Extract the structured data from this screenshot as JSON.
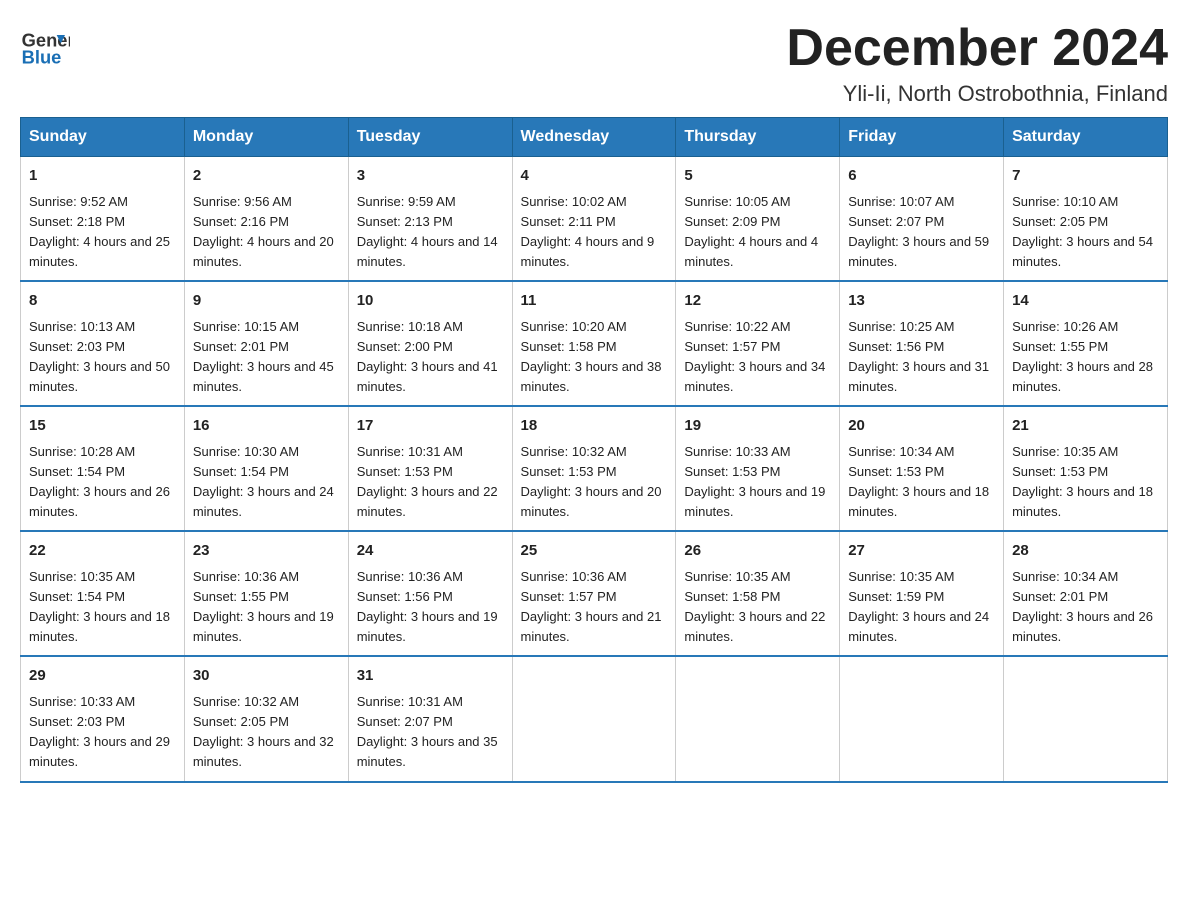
{
  "header": {
    "logo_general": "General",
    "logo_blue": "Blue",
    "month_title": "December 2024",
    "location": "Yli-Ii, North Ostrobothnia, Finland"
  },
  "days_of_week": [
    "Sunday",
    "Monday",
    "Tuesday",
    "Wednesday",
    "Thursday",
    "Friday",
    "Saturday"
  ],
  "weeks": [
    [
      {
        "day": "1",
        "sunrise": "Sunrise: 9:52 AM",
        "sunset": "Sunset: 2:18 PM",
        "daylight": "Daylight: 4 hours and 25 minutes."
      },
      {
        "day": "2",
        "sunrise": "Sunrise: 9:56 AM",
        "sunset": "Sunset: 2:16 PM",
        "daylight": "Daylight: 4 hours and 20 minutes."
      },
      {
        "day": "3",
        "sunrise": "Sunrise: 9:59 AM",
        "sunset": "Sunset: 2:13 PM",
        "daylight": "Daylight: 4 hours and 14 minutes."
      },
      {
        "day": "4",
        "sunrise": "Sunrise: 10:02 AM",
        "sunset": "Sunset: 2:11 PM",
        "daylight": "Daylight: 4 hours and 9 minutes."
      },
      {
        "day": "5",
        "sunrise": "Sunrise: 10:05 AM",
        "sunset": "Sunset: 2:09 PM",
        "daylight": "Daylight: 4 hours and 4 minutes."
      },
      {
        "day": "6",
        "sunrise": "Sunrise: 10:07 AM",
        "sunset": "Sunset: 2:07 PM",
        "daylight": "Daylight: 3 hours and 59 minutes."
      },
      {
        "day": "7",
        "sunrise": "Sunrise: 10:10 AM",
        "sunset": "Sunset: 2:05 PM",
        "daylight": "Daylight: 3 hours and 54 minutes."
      }
    ],
    [
      {
        "day": "8",
        "sunrise": "Sunrise: 10:13 AM",
        "sunset": "Sunset: 2:03 PM",
        "daylight": "Daylight: 3 hours and 50 minutes."
      },
      {
        "day": "9",
        "sunrise": "Sunrise: 10:15 AM",
        "sunset": "Sunset: 2:01 PM",
        "daylight": "Daylight: 3 hours and 45 minutes."
      },
      {
        "day": "10",
        "sunrise": "Sunrise: 10:18 AM",
        "sunset": "Sunset: 2:00 PM",
        "daylight": "Daylight: 3 hours and 41 minutes."
      },
      {
        "day": "11",
        "sunrise": "Sunrise: 10:20 AM",
        "sunset": "Sunset: 1:58 PM",
        "daylight": "Daylight: 3 hours and 38 minutes."
      },
      {
        "day": "12",
        "sunrise": "Sunrise: 10:22 AM",
        "sunset": "Sunset: 1:57 PM",
        "daylight": "Daylight: 3 hours and 34 minutes."
      },
      {
        "day": "13",
        "sunrise": "Sunrise: 10:25 AM",
        "sunset": "Sunset: 1:56 PM",
        "daylight": "Daylight: 3 hours and 31 minutes."
      },
      {
        "day": "14",
        "sunrise": "Sunrise: 10:26 AM",
        "sunset": "Sunset: 1:55 PM",
        "daylight": "Daylight: 3 hours and 28 minutes."
      }
    ],
    [
      {
        "day": "15",
        "sunrise": "Sunrise: 10:28 AM",
        "sunset": "Sunset: 1:54 PM",
        "daylight": "Daylight: 3 hours and 26 minutes."
      },
      {
        "day": "16",
        "sunrise": "Sunrise: 10:30 AM",
        "sunset": "Sunset: 1:54 PM",
        "daylight": "Daylight: 3 hours and 24 minutes."
      },
      {
        "day": "17",
        "sunrise": "Sunrise: 10:31 AM",
        "sunset": "Sunset: 1:53 PM",
        "daylight": "Daylight: 3 hours and 22 minutes."
      },
      {
        "day": "18",
        "sunrise": "Sunrise: 10:32 AM",
        "sunset": "Sunset: 1:53 PM",
        "daylight": "Daylight: 3 hours and 20 minutes."
      },
      {
        "day": "19",
        "sunrise": "Sunrise: 10:33 AM",
        "sunset": "Sunset: 1:53 PM",
        "daylight": "Daylight: 3 hours and 19 minutes."
      },
      {
        "day": "20",
        "sunrise": "Sunrise: 10:34 AM",
        "sunset": "Sunset: 1:53 PM",
        "daylight": "Daylight: 3 hours and 18 minutes."
      },
      {
        "day": "21",
        "sunrise": "Sunrise: 10:35 AM",
        "sunset": "Sunset: 1:53 PM",
        "daylight": "Daylight: 3 hours and 18 minutes."
      }
    ],
    [
      {
        "day": "22",
        "sunrise": "Sunrise: 10:35 AM",
        "sunset": "Sunset: 1:54 PM",
        "daylight": "Daylight: 3 hours and 18 minutes."
      },
      {
        "day": "23",
        "sunrise": "Sunrise: 10:36 AM",
        "sunset": "Sunset: 1:55 PM",
        "daylight": "Daylight: 3 hours and 19 minutes."
      },
      {
        "day": "24",
        "sunrise": "Sunrise: 10:36 AM",
        "sunset": "Sunset: 1:56 PM",
        "daylight": "Daylight: 3 hours and 19 minutes."
      },
      {
        "day": "25",
        "sunrise": "Sunrise: 10:36 AM",
        "sunset": "Sunset: 1:57 PM",
        "daylight": "Daylight: 3 hours and 21 minutes."
      },
      {
        "day": "26",
        "sunrise": "Sunrise: 10:35 AM",
        "sunset": "Sunset: 1:58 PM",
        "daylight": "Daylight: 3 hours and 22 minutes."
      },
      {
        "day": "27",
        "sunrise": "Sunrise: 10:35 AM",
        "sunset": "Sunset: 1:59 PM",
        "daylight": "Daylight: 3 hours and 24 minutes."
      },
      {
        "day": "28",
        "sunrise": "Sunrise: 10:34 AM",
        "sunset": "Sunset: 2:01 PM",
        "daylight": "Daylight: 3 hours and 26 minutes."
      }
    ],
    [
      {
        "day": "29",
        "sunrise": "Sunrise: 10:33 AM",
        "sunset": "Sunset: 2:03 PM",
        "daylight": "Daylight: 3 hours and 29 minutes."
      },
      {
        "day": "30",
        "sunrise": "Sunrise: 10:32 AM",
        "sunset": "Sunset: 2:05 PM",
        "daylight": "Daylight: 3 hours and 32 minutes."
      },
      {
        "day": "31",
        "sunrise": "Sunrise: 10:31 AM",
        "sunset": "Sunset: 2:07 PM",
        "daylight": "Daylight: 3 hours and 35 minutes."
      },
      {
        "day": "",
        "sunrise": "",
        "sunset": "",
        "daylight": ""
      },
      {
        "day": "",
        "sunrise": "",
        "sunset": "",
        "daylight": ""
      },
      {
        "day": "",
        "sunrise": "",
        "sunset": "",
        "daylight": ""
      },
      {
        "day": "",
        "sunrise": "",
        "sunset": "",
        "daylight": ""
      }
    ]
  ]
}
